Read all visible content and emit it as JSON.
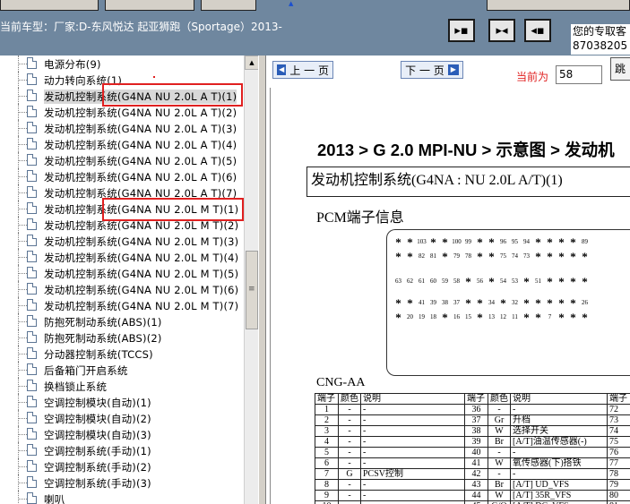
{
  "header": {
    "vehicle_label": "当前车型：厂家:D-东风悦达 起亚狮跑（Sportage）2013-",
    "nav_icons": [
      "arrow-right-icon",
      "arrows-inward-icon",
      "arrow-left-icon"
    ],
    "contact_line1": "您的专取客",
    "contact_line2": "87038205"
  },
  "tree": {
    "items": [
      {
        "label": "电源分布(9)"
      },
      {
        "label": "动力转向系统(1)"
      },
      {
        "label": "发动机控制系统(G4NA NU 2.0L A T)(1)",
        "selected": true
      },
      {
        "label": "发动机控制系统(G4NA NU 2.0L A T)(2)"
      },
      {
        "label": "发动机控制系统(G4NA NU 2.0L A T)(3)"
      },
      {
        "label": "发动机控制系统(G4NA NU 2.0L A T)(4)"
      },
      {
        "label": "发动机控制系统(G4NA NU 2.0L A T)(5)"
      },
      {
        "label": "发动机控制系统(G4NA NU 2.0L A T)(6)"
      },
      {
        "label": "发动机控制系统(G4NA NU 2.0L A T)(7)"
      },
      {
        "label": "发动机控制系统(G4NA NU 2.0L M T)(1)"
      },
      {
        "label": "发动机控制系统(G4NA NU 2.0L M T)(2)"
      },
      {
        "label": "发动机控制系统(G4NA NU 2.0L M T)(3)"
      },
      {
        "label": "发动机控制系统(G4NA NU 2.0L M T)(4)"
      },
      {
        "label": "发动机控制系统(G4NA NU 2.0L M T)(5)"
      },
      {
        "label": "发动机控制系统(G4NA NU 2.0L M T)(6)"
      },
      {
        "label": "发动机控制系统(G4NA NU 2.0L M T)(7)"
      },
      {
        "label": "防抱死制动系统(ABS)(1)"
      },
      {
        "label": "防抱死制动系统(ABS)(2)"
      },
      {
        "label": "分动器控制系统(TCCS)"
      },
      {
        "label": "后备箱门开启系统"
      },
      {
        "label": "换档锁止系统"
      },
      {
        "label": "空调控制模块(自动)(1)"
      },
      {
        "label": "空调控制模块(自动)(2)"
      },
      {
        "label": "空调控制模块(自动)(3)"
      },
      {
        "label": "空调控制系统(手动)(1)"
      },
      {
        "label": "空调控制系统(手动)(2)"
      },
      {
        "label": "空调控制系统(手动)(3)"
      },
      {
        "label": "喇叭"
      }
    ]
  },
  "doc": {
    "prev_label": "上 一 页",
    "next_label": "下 一 页",
    "current_label": "当前为",
    "current_page": "58",
    "jump_label": "跳",
    "breadcrumb": "2013 > G 2.0 MPI-NU > 示意图 > 发动机",
    "section_title": "发动机控制系统(G4NA : NU 2.0L A/T)(1)",
    "pcm_title": "PCM端子信息",
    "connector_rows": [
      [
        "*",
        "*",
        "103",
        "*",
        "*",
        "100",
        "99",
        "*",
        "*",
        "96",
        "95",
        "94",
        "*",
        "*",
        "*",
        "*",
        "89"
      ],
      [
        "*",
        "*",
        "82",
        "81",
        "*",
        "79",
        "78",
        "*",
        "*",
        "75",
        "74",
        "73",
        "*",
        "*",
        "*",
        "*",
        "*"
      ],
      [
        "63",
        "62",
        "61",
        "60",
        "59",
        "58",
        "*",
        "56",
        "*",
        "54",
        "53",
        "*",
        "51",
        "*",
        "*",
        "*",
        "*"
      ],
      [
        "*",
        "*",
        "41",
        "39",
        "38",
        "37",
        "*",
        "*",
        "34",
        "*",
        "32",
        "*",
        "*",
        "*",
        "*",
        "*",
        "26"
      ],
      [
        "*",
        "20",
        "19",
        "18",
        "*",
        "16",
        "15",
        "*",
        "13",
        "12",
        "11",
        "*",
        "*",
        "7",
        "*",
        "*",
        "*"
      ]
    ],
    "cng_label": "CNG-AA",
    "table_headers": [
      "端子",
      "颜色",
      "说明",
      "端子",
      "颜色",
      "说明",
      "端子"
    ],
    "table_rows": [
      [
        "1",
        "-",
        "-",
        "36",
        "-",
        "-",
        "72"
      ],
      [
        "2",
        "-",
        "-",
        "37",
        "Gr",
        "升档",
        "73"
      ],
      [
        "3",
        "-",
        "-",
        "38",
        "W",
        "选择开关",
        "74"
      ],
      [
        "4",
        "-",
        "-",
        "39",
        "Br",
        "[A/T]油温传感器(-)",
        "75"
      ],
      [
        "5",
        "-",
        "-",
        "40",
        "-",
        "-",
        "76"
      ],
      [
        "6",
        "-",
        "-",
        "41",
        "W",
        "氧传感器(下)搭铁",
        "77"
      ],
      [
        "7",
        "G",
        "PCSV控制",
        "42",
        "-",
        "-",
        "78"
      ],
      [
        "8",
        "-",
        "-",
        "43",
        "Br",
        "[A/T] UD_VFS",
        "79"
      ],
      [
        "9",
        "-",
        "-",
        "44",
        "W",
        "[A/T] 35R_VFS",
        "80"
      ],
      [
        "10",
        "-",
        "-",
        "45",
        "G/O",
        "[A/T] DC_VFS",
        "81"
      ],
      [
        "11",
        "L",
        "歧管绝对压力传感器电源",
        "46",
        "P",
        "[A/T] V_VFS",
        "82"
      ]
    ]
  }
}
